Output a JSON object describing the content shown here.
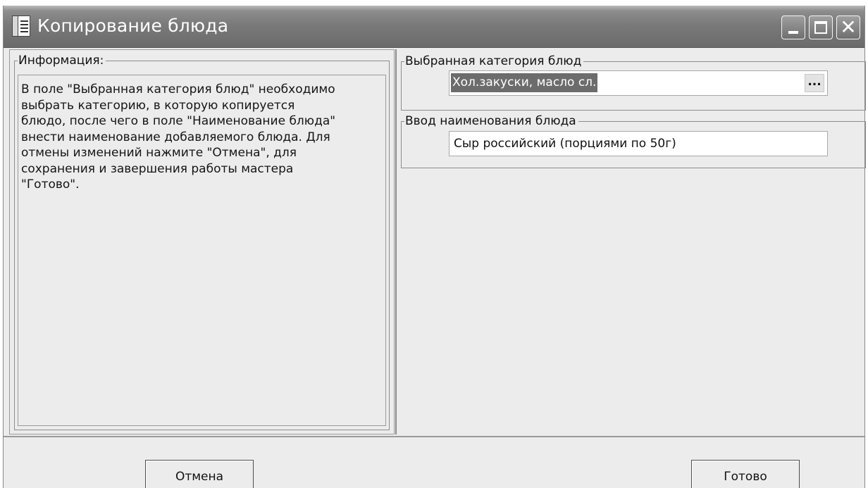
{
  "window": {
    "title": "Копирование блюда",
    "icon": "document-list-icon",
    "controls": {
      "minimize": "minimize-icon",
      "maximize": "maximize-icon",
      "close": "✕"
    }
  },
  "info": {
    "legend": "Информация:",
    "text": "В поле \"Выбранная категория блюд\" необходимо\nвыбрать категорию, в которую копируется\nблюдо, после чего в поле \"Наименование блюда\"\nвнести наименование добавляемого блюда. Для\nотмены изменений нажмите \"Отмена\", для\nсохранения и завершения работы мастера\n\"Готово\"."
  },
  "category": {
    "legend": "Выбранная категория блюд",
    "value": "Хол.закуски, масло сл.",
    "browse_label": "..."
  },
  "dish_name": {
    "legend": "Ввод наименования блюда",
    "value": "Сыр российский (порциями по 50г)"
  },
  "buttons": {
    "cancel": "Отмена",
    "done": "Готово"
  },
  "colors": {
    "titlebar": "#7a7a7a",
    "background": "#ececec",
    "selection": "#6c6c6c"
  }
}
